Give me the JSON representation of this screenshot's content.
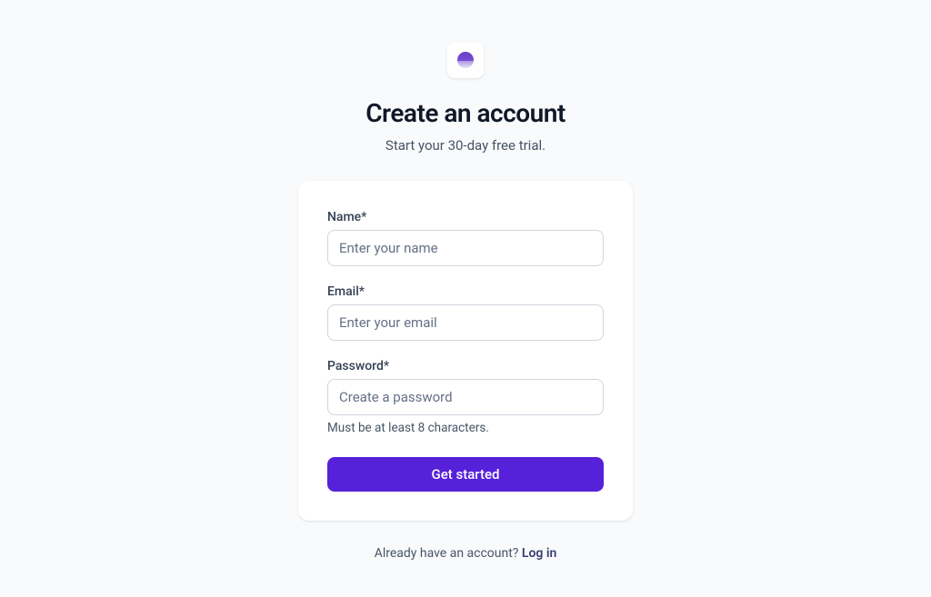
{
  "header": {
    "title": "Create an account",
    "subtitle": "Start your 30-day free trial."
  },
  "form": {
    "name": {
      "label": "Name*",
      "placeholder": "Enter your name",
      "value": ""
    },
    "email": {
      "label": "Email*",
      "placeholder": "Enter your email",
      "value": ""
    },
    "password": {
      "label": "Password*",
      "placeholder": "Create a password",
      "value": "",
      "hint": "Must be at least 8 characters."
    },
    "submit_label": "Get started"
  },
  "footer": {
    "prompt": "Already have an account? ",
    "link_label": "Log in"
  },
  "colors": {
    "primary": "#5720d9",
    "text_dark": "#101828",
    "text_muted": "#475467",
    "border": "#d0d5dd",
    "link": "#363f72"
  }
}
